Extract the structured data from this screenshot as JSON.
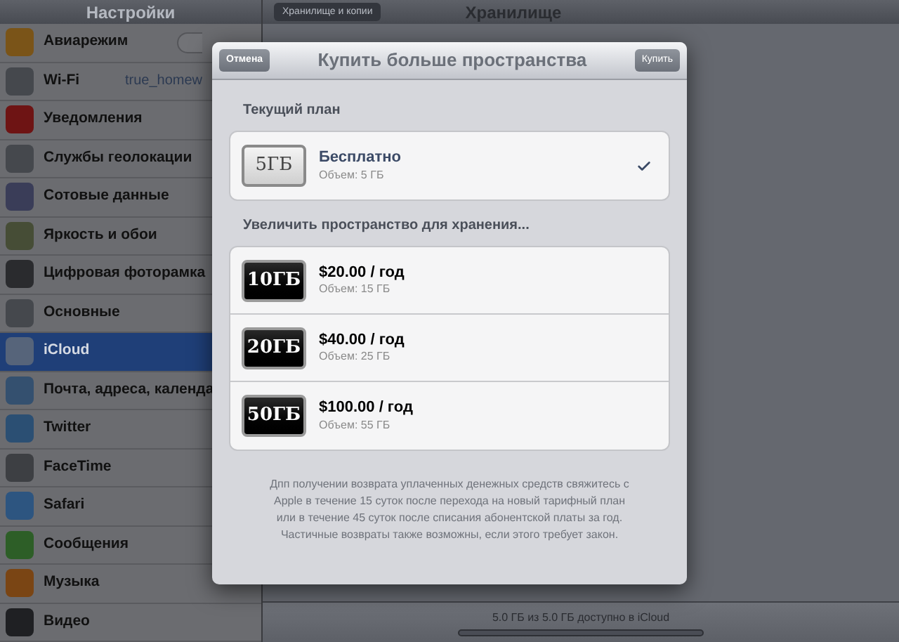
{
  "sidebar": {
    "title": "Настройки",
    "items": [
      {
        "label": "Авиарежим",
        "color": "#7a5418",
        "selected": false,
        "kind": "toggle",
        "on": false
      },
      {
        "label": "Wi-Fi",
        "color": "#45484d",
        "selected": false,
        "kind": "value",
        "value": "true_homew"
      },
      {
        "label": "Уведомления",
        "color": "#6e1414",
        "selected": false,
        "kind": "plain"
      },
      {
        "label": "Службы геолокации",
        "color": "#45484d",
        "selected": false,
        "kind": "plain"
      },
      {
        "label": "Сотовые данные",
        "color": "#3a3d58",
        "selected": false,
        "kind": "plain"
      },
      {
        "label": "Яркость и обои",
        "color": "#464d36",
        "selected": false,
        "kind": "plain"
      },
      {
        "label": "Цифровая фоторамка",
        "color": "#2a2b2e",
        "selected": false,
        "kind": "plain"
      },
      {
        "label": "Основные",
        "color": "#45484d",
        "selected": false,
        "kind": "plain"
      },
      {
        "label": "iCloud",
        "color": "#56647a",
        "selected": true,
        "kind": "plain"
      },
      {
        "label": "Почта, адреса, календа",
        "color": "#34506f",
        "selected": false,
        "kind": "plain"
      },
      {
        "label": "Twitter",
        "color": "#2b4f73",
        "selected": false,
        "kind": "plain"
      },
      {
        "label": "FaceTime",
        "color": "#3d3f43",
        "selected": false,
        "kind": "plain"
      },
      {
        "label": "Safari",
        "color": "#2d5580",
        "selected": false,
        "kind": "plain"
      },
      {
        "label": "Сообщения",
        "color": "#2d5e27",
        "selected": false,
        "kind": "plain"
      },
      {
        "label": "Музыка",
        "color": "#7a4514",
        "selected": false,
        "kind": "plain"
      },
      {
        "label": "Видео",
        "color": "#1f2023",
        "selected": false,
        "kind": "plain"
      }
    ]
  },
  "detail": {
    "back_button": "Хранилище и копии",
    "title": "Хранилище",
    "storage_text": "5.0 ГБ из 5.0 ГБ доступно в iCloud",
    "level": 0
  },
  "dialog": {
    "cancel_button": "Отмена",
    "title": "Купить больше пространства",
    "buy_button": "Купить",
    "current_heading": "Текущий план",
    "current_plans": [
      {
        "kind": "free",
        "badge": "5ГБ",
        "title": "Бесплатно",
        "subtitle": "Объем: 5 ГБ",
        "selected": true
      }
    ],
    "upgrade_heading": "Увеличить пространство для хранения...",
    "upgrade_plans": [
      {
        "kind": "paid",
        "badge": "10ГБ",
        "title": "$20.00 / год",
        "subtitle": "Объем: 15 ГБ",
        "selected": false
      },
      {
        "kind": "paid",
        "badge": "20ГБ",
        "title": "$40.00 / год",
        "subtitle": "Объем: 25 ГБ",
        "selected": false
      },
      {
        "kind": "paid",
        "badge": "50ГБ",
        "title": "$100.00 / год",
        "subtitle": "Объем: 55 ГБ",
        "selected": false
      }
    ],
    "footnote": "Дпп получении возврата уплаченных денежных средств свяжитесь с Apple в течение 15 суток после перехода на новый тарифный план или в течение 45 суток после списания абонентской платы за год. Частичные возвраты также возможны, если этого требует закон."
  }
}
